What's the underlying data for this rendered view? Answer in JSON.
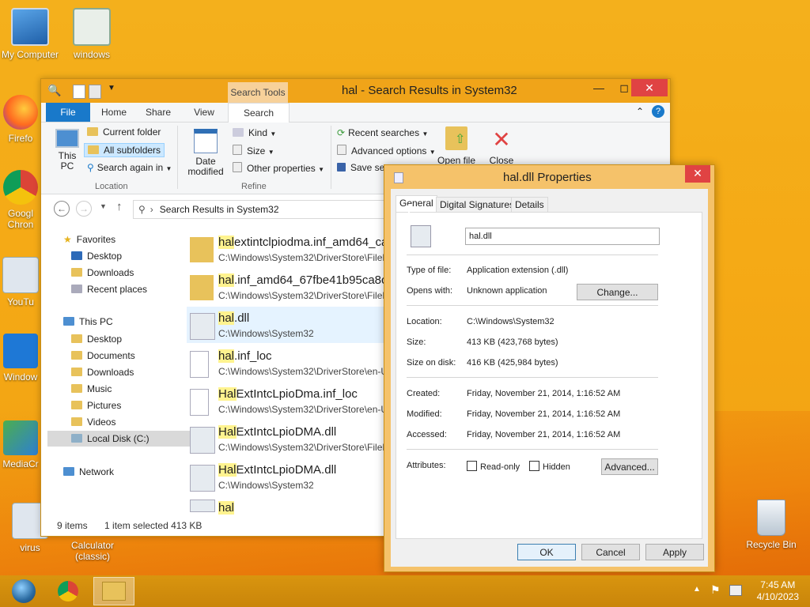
{
  "desktop": {
    "icons": [
      {
        "label": "My Computer"
      },
      {
        "label": "windows"
      },
      {
        "label": "Firefo"
      },
      {
        "label": "Googl Chron"
      },
      {
        "label": "YouTu"
      },
      {
        "label": "Window"
      },
      {
        "label": "MediaCr"
      },
      {
        "label": "virus"
      },
      {
        "label": "Calculator (classic)"
      },
      {
        "label": "Recycle Bin"
      }
    ]
  },
  "explorer": {
    "title": "hal - Search Results in System32",
    "context_tab": "Search Tools",
    "ribbon_tabs": [
      "File",
      "Home",
      "Share",
      "View",
      "Search"
    ],
    "ribbon": {
      "this_pc": "This PC",
      "current_folder": "Current folder",
      "all_subfolders": "All subfolders",
      "search_again_in": "Search again in",
      "location_group": "Location",
      "date_modified": "Date modified",
      "kind": "Kind",
      "size": "Size",
      "other_properties": "Other properties",
      "refine_group": "Refine",
      "recent_searches": "Recent searches",
      "advanced_options": "Advanced options",
      "save_search": "Save sea",
      "open_file_location": "Open file",
      "close_search": "Close"
    },
    "address": "Search Results in System32",
    "nav": {
      "favorites": "Favorites",
      "fav_items": [
        "Desktop",
        "Downloads",
        "Recent places"
      ],
      "this_pc": "This PC",
      "pc_items": [
        "Desktop",
        "Documents",
        "Downloads",
        "Music",
        "Pictures",
        "Videos",
        "Local Disk (C:)"
      ],
      "network": "Network"
    },
    "results": [
      {
        "hl": "hal",
        "rest": "extintclpiodma.inf_amd64_ca",
        "path": "C:\\Windows\\System32\\DriverStore\\FileR"
      },
      {
        "hl": "hal",
        "rest": ".inf_amd64_67fbe41b95ca8ca",
        "path": "C:\\Windows\\System32\\DriverStore\\FileR"
      },
      {
        "hl": "hal",
        "rest": ".dll",
        "path": "C:\\Windows\\System32"
      },
      {
        "hl": "hal",
        "rest": ".inf_loc",
        "path": "C:\\Windows\\System32\\DriverStore\\en-U"
      },
      {
        "hl": "Hal",
        "rest": "ExtIntcLpioDma.inf_loc",
        "path": "C:\\Windows\\System32\\DriverStore\\en-U"
      },
      {
        "hl": "Hal",
        "rest": "ExtIntcLpioDMA.dll",
        "path": "C:\\Windows\\System32\\DriverStore\\FileR"
      },
      {
        "hl": "Hal",
        "rest": "ExtIntcLpioDMA.dll",
        "path": "C:\\Windows\\System32"
      },
      {
        "hl": "hal",
        "rest": "",
        "path": ""
      }
    ],
    "status": {
      "count": "9 items",
      "selected": "1 item selected  413 KB"
    }
  },
  "dialog": {
    "title": "hal.dll Properties",
    "tabs": [
      "General",
      "Digital Signatures",
      "Details"
    ],
    "filename": "hal.dll",
    "type_label": "Type of file:",
    "type_value": "Application extension (.dll)",
    "opens_label": "Opens with:",
    "opens_value": "Unknown application",
    "change_btn": "Change...",
    "location_label": "Location:",
    "location_value": "C:\\Windows\\System32",
    "size_label": "Size:",
    "size_value": "413 KB (423,768 bytes)",
    "sod_label": "Size on disk:",
    "sod_value": "416 KB (425,984 bytes)",
    "created_label": "Created:",
    "created_value": "Friday, November 21, 2014, 1:16:52 AM",
    "modified_label": "Modified:",
    "modified_value": "Friday, November 21, 2014, 1:16:52 AM",
    "accessed_label": "Accessed:",
    "accessed_value": "Friday, November 21, 2014, 1:16:52 AM",
    "attributes_label": "Attributes:",
    "readonly_label": "Read-only",
    "hidden_label": "Hidden",
    "advanced_btn": "Advanced...",
    "ok_btn": "OK",
    "cancel_btn": "Cancel",
    "apply_btn": "Apply"
  },
  "taskbar": {
    "time": "7:45 AM",
    "date": "4/10/2023"
  }
}
